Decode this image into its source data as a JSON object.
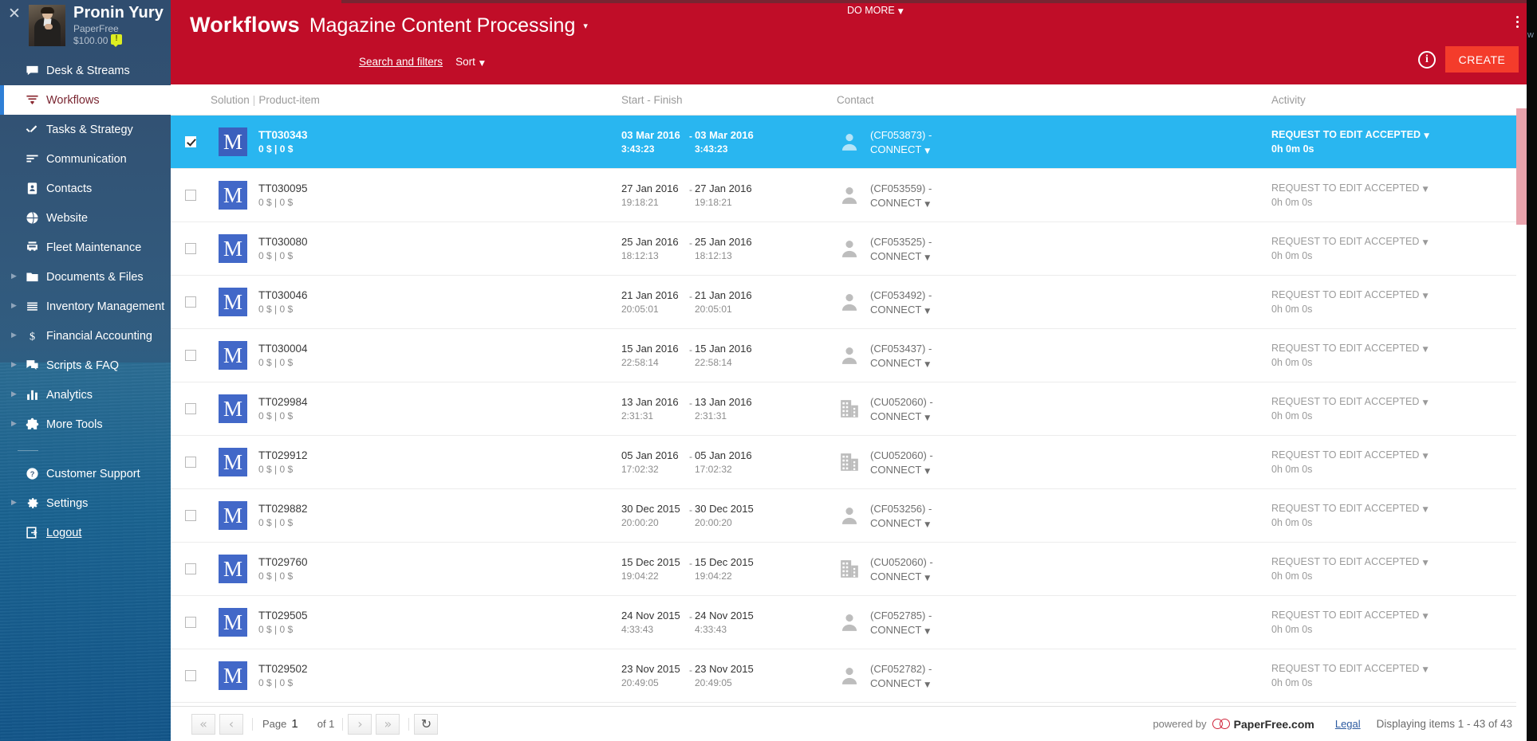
{
  "sidebar": {
    "close_icon": "close-icon",
    "profile": {
      "name": "Pronin Yury",
      "org": "PaperFree",
      "balance": "$100.00",
      "badge": "!"
    },
    "items": [
      {
        "label": "Desk & Streams",
        "icon": "chat-icon",
        "expandable": false,
        "active": false
      },
      {
        "label": "Workflows",
        "icon": "funnel-icon",
        "expandable": false,
        "active": true
      },
      {
        "label": "Tasks & Strategy",
        "icon": "double-check-icon",
        "expandable": false,
        "active": false
      },
      {
        "label": "Communication",
        "icon": "lines-icon",
        "expandable": false,
        "active": false
      },
      {
        "label": "Contacts",
        "icon": "contact-card-icon",
        "expandable": false,
        "active": false
      },
      {
        "label": "Website",
        "icon": "globe-icon",
        "expandable": false,
        "active": false
      },
      {
        "label": "Fleet Maintenance",
        "icon": "car-icon",
        "expandable": false,
        "active": false
      },
      {
        "label": "Documents & Files",
        "icon": "folder-icon",
        "expandable": true,
        "active": false
      },
      {
        "label": "Inventory Management",
        "icon": "stack-icon",
        "expandable": true,
        "active": false
      },
      {
        "label": "Financial Accounting",
        "icon": "dollar-icon",
        "expandable": true,
        "active": false
      },
      {
        "label": "Scripts & FAQ",
        "icon": "chat-bubbles-icon",
        "expandable": true,
        "active": false
      },
      {
        "label": "Analytics",
        "icon": "bar-chart-icon",
        "expandable": true,
        "active": false
      },
      {
        "label": "More Tools",
        "icon": "puzzle-icon",
        "expandable": true,
        "active": false
      }
    ],
    "bottom_items": [
      {
        "label": "Customer Support",
        "icon": "question-circle-icon",
        "expandable": false,
        "underline": false
      },
      {
        "label": "Settings",
        "icon": "gear-icon",
        "expandable": true,
        "underline": false
      },
      {
        "label": "Logout",
        "icon": "logout-icon",
        "expandable": false,
        "underline": true
      }
    ]
  },
  "header": {
    "title": "Workflows",
    "subtitle": "Magazine Content Processing",
    "subtitle_caret": "▾",
    "search_and_filters": "Search and filters",
    "sort": "Sort",
    "do_more": "DO MORE",
    "info_icon": "info-icon",
    "kebab_icon": "more-vertical-icon",
    "create_button": "CREATE",
    "accent_color": "#c00d28",
    "create_color": "#f43c2b"
  },
  "table": {
    "columns": {
      "solution": "Solution",
      "separator": "|",
      "product_item": "Product-item",
      "start_finish": "Start - Finish",
      "contact": "Contact",
      "activity": "Activity"
    },
    "selected_color": "#29b6f0",
    "rows": [
      {
        "id": "TT030343",
        "badge": "M",
        "amount": "0 $ | 0 $",
        "start_date": "03 Mar 2016",
        "start_time": "3:43:23",
        "finish_date": "03 Mar 2016",
        "finish_time": "3:43:23",
        "contact_id": "(CF053873) -",
        "contact_action": "CONNECT",
        "contact_icon": "person-icon",
        "activity": "REQUEST TO EDIT ACCEPTED",
        "duration": "0h 0m 0s",
        "selected": true,
        "checked": true
      },
      {
        "id": "TT030095",
        "badge": "M",
        "amount": "0 $ | 0 $",
        "start_date": "27 Jan 2016",
        "start_time": "19:18:21",
        "finish_date": "27 Jan 2016",
        "finish_time": "19:18:21",
        "contact_id": "(CF053559) -",
        "contact_action": "CONNECT",
        "contact_icon": "person-icon",
        "activity": "REQUEST TO EDIT ACCEPTED",
        "duration": "0h 0m 0s",
        "selected": false,
        "checked": false
      },
      {
        "id": "TT030080",
        "badge": "M",
        "amount": "0 $ | 0 $",
        "start_date": "25 Jan 2016",
        "start_time": "18:12:13",
        "finish_date": "25 Jan 2016",
        "finish_time": "18:12:13",
        "contact_id": "(CF053525) -",
        "contact_action": "CONNECT",
        "contact_icon": "person-icon",
        "activity": "REQUEST TO EDIT ACCEPTED",
        "duration": "0h 0m 0s",
        "selected": false,
        "checked": false
      },
      {
        "id": "TT030046",
        "badge": "M",
        "amount": "0 $ | 0 $",
        "start_date": "21 Jan 2016",
        "start_time": "20:05:01",
        "finish_date": "21 Jan 2016",
        "finish_time": "20:05:01",
        "contact_id": "(CF053492) -",
        "contact_action": "CONNECT",
        "contact_icon": "person-icon",
        "activity": "REQUEST TO EDIT ACCEPTED",
        "duration": "0h 0m 0s",
        "selected": false,
        "checked": false
      },
      {
        "id": "TT030004",
        "badge": "M",
        "amount": "0 $ | 0 $",
        "start_date": "15 Jan 2016",
        "start_time": "22:58:14",
        "finish_date": "15 Jan 2016",
        "finish_time": "22:58:14",
        "contact_id": "(CF053437) -",
        "contact_action": "CONNECT",
        "contact_icon": "person-icon",
        "activity": "REQUEST TO EDIT ACCEPTED",
        "duration": "0h 0m 0s",
        "selected": false,
        "checked": false
      },
      {
        "id": "TT029984",
        "badge": "M",
        "amount": "0 $ | 0 $",
        "start_date": "13 Jan 2016",
        "start_time": "2:31:31",
        "finish_date": "13 Jan 2016",
        "finish_time": "2:31:31",
        "contact_id": "(CU052060) -",
        "contact_action": "CONNECT",
        "contact_icon": "building-icon",
        "activity": "REQUEST TO EDIT ACCEPTED",
        "duration": "0h 0m 0s",
        "selected": false,
        "checked": false
      },
      {
        "id": "TT029912",
        "badge": "M",
        "amount": "0 $ | 0 $",
        "start_date": "05 Jan 2016",
        "start_time": "17:02:32",
        "finish_date": "05 Jan 2016",
        "finish_time": "17:02:32",
        "contact_id": "(CU052060) -",
        "contact_action": "CONNECT",
        "contact_icon": "building-icon",
        "activity": "REQUEST TO EDIT ACCEPTED",
        "duration": "0h 0m 0s",
        "selected": false,
        "checked": false
      },
      {
        "id": "TT029882",
        "badge": "M",
        "amount": "0 $ | 0 $",
        "start_date": "30 Dec 2015",
        "start_time": "20:00:20",
        "finish_date": "30 Dec 2015",
        "finish_time": "20:00:20",
        "contact_id": "(CF053256) -",
        "contact_action": "CONNECT",
        "contact_icon": "person-icon",
        "activity": "REQUEST TO EDIT ACCEPTED",
        "duration": "0h 0m 0s",
        "selected": false,
        "checked": false
      },
      {
        "id": "TT029760",
        "badge": "M",
        "amount": "0 $ | 0 $",
        "start_date": "15 Dec 2015",
        "start_time": "19:04:22",
        "finish_date": "15 Dec 2015",
        "finish_time": "19:04:22",
        "contact_id": "(CU052060) -",
        "contact_action": "CONNECT",
        "contact_icon": "building-icon",
        "activity": "REQUEST TO EDIT ACCEPTED",
        "duration": "0h 0m 0s",
        "selected": false,
        "checked": false
      },
      {
        "id": "TT029505",
        "badge": "M",
        "amount": "0 $ | 0 $",
        "start_date": "24 Nov 2015",
        "start_time": "4:33:43",
        "finish_date": "24 Nov 2015",
        "finish_time": "4:33:43",
        "contact_id": "(CF052785) -",
        "contact_action": "CONNECT",
        "contact_icon": "person-icon",
        "activity": "REQUEST TO EDIT ACCEPTED",
        "duration": "0h 0m 0s",
        "selected": false,
        "checked": false
      },
      {
        "id": "TT029502",
        "badge": "M",
        "amount": "0 $ | 0 $",
        "start_date": "23 Nov 2015",
        "start_time": "20:49:05",
        "finish_date": "23 Nov 2015",
        "finish_time": "20:49:05",
        "contact_id": "(CF052782) -",
        "contact_action": "CONNECT",
        "contact_icon": "person-icon",
        "activity": "REQUEST TO EDIT ACCEPTED",
        "duration": "0h 0m 0s",
        "selected": false,
        "checked": false
      }
    ]
  },
  "footer": {
    "first_icon": "double-chevron-left-icon",
    "prev_icon": "chevron-left-icon",
    "next_icon": "chevron-right-icon",
    "last_icon": "double-chevron-right-icon",
    "refresh_icon": "refresh-icon",
    "page_label": "Page",
    "page_number": "1",
    "page_of": "of 1",
    "powered_by": "powered by",
    "brand": "PaperFree.com",
    "legal": "Legal",
    "displaying": "Displaying items 1 - 43 of 43"
  }
}
